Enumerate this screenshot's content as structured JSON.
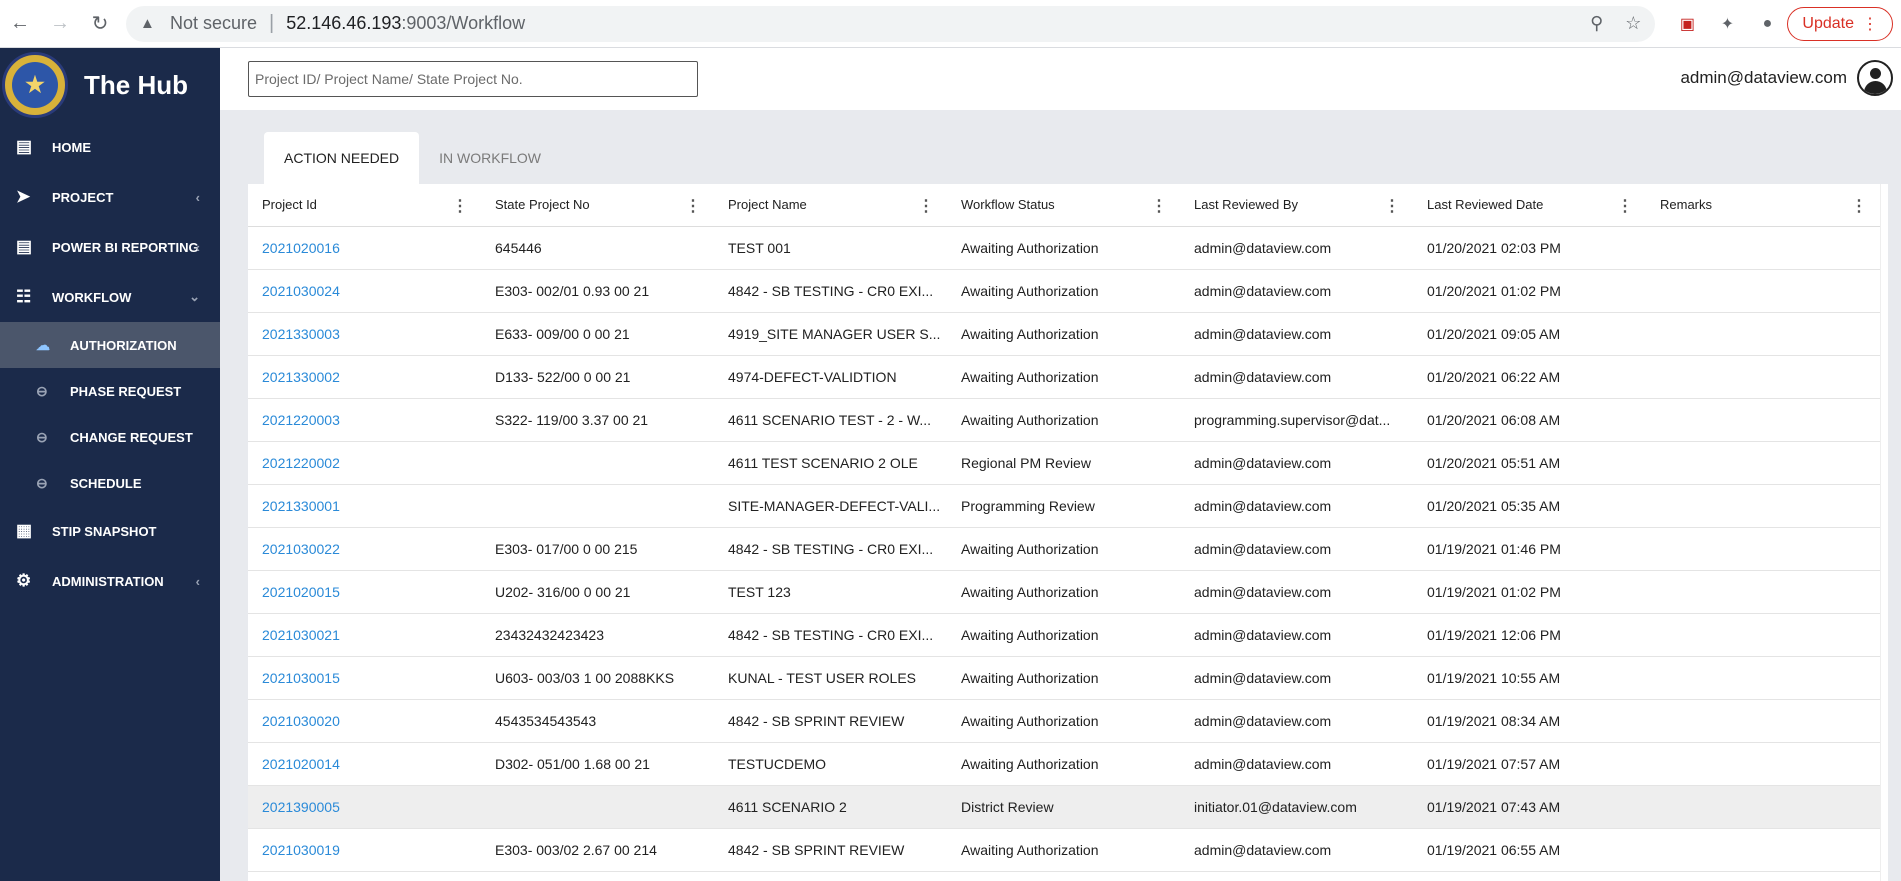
{
  "browser": {
    "security_label": "Not secure",
    "url_host": "52.146.46.193",
    "url_path": ":9003/Workflow",
    "update_label": "Update"
  },
  "sidebar": {
    "brand_title": "The Hub",
    "items": [
      {
        "label": "HOME",
        "icon": "report-icon"
      },
      {
        "label": "PROJECT",
        "icon": "rocket-icon"
      },
      {
        "label": "POWER BI REPORTING",
        "icon": "chart-report-icon"
      },
      {
        "label": "WORKFLOW",
        "icon": "workflow-icon"
      },
      {
        "label": "STIP SNAPSHOT",
        "icon": "snapshot-icon"
      },
      {
        "label": "ADMINISTRATION",
        "icon": "gear-icon"
      }
    ],
    "workflow_sub": [
      {
        "label": "AUTHORIZATION"
      },
      {
        "label": "PHASE REQUEST"
      },
      {
        "label": "CHANGE REQUEST"
      },
      {
        "label": "SCHEDULE"
      }
    ]
  },
  "topbar": {
    "search_placeholder": "Project ID/ Project Name/ State Project No.",
    "user_email": "admin@dataview.com"
  },
  "tabs": [
    {
      "label": "ACTION NEEDED",
      "active": true
    },
    {
      "label": "IN WORKFLOW",
      "active": false
    }
  ],
  "table": {
    "columns": [
      "Project Id",
      "State Project No",
      "Project Name",
      "Workflow Status",
      "Last Reviewed By",
      "Last Reviewed Date",
      "Remarks"
    ],
    "rows": [
      [
        "2021020016",
        "645446",
        "TEST 001",
        "Awaiting Authorization",
        "admin@dataview.com",
        "01/20/2021 02:03 PM",
        ""
      ],
      [
        "2021030024",
        "E303- 002/01 0.93 00 21",
        "4842 - SB TESTING - CR0 EXI...",
        "Awaiting Authorization",
        "admin@dataview.com",
        "01/20/2021 01:02 PM",
        ""
      ],
      [
        "2021330003",
        "E633- 009/00 0 00 21",
        "4919_SITE MANAGER USER S...",
        "Awaiting Authorization",
        "admin@dataview.com",
        "01/20/2021 09:05 AM",
        ""
      ],
      [
        "2021330002",
        "D133- 522/00 0 00 21",
        "4974-DEFECT-VALIDTION",
        "Awaiting Authorization",
        "admin@dataview.com",
        "01/20/2021 06:22 AM",
        ""
      ],
      [
        "2021220003",
        "S322- 119/00 3.37 00 21",
        "4611 SCENARIO TEST - 2 - W...",
        "Awaiting Authorization",
        "programming.supervisor@dat...",
        "01/20/2021 06:08 AM",
        ""
      ],
      [
        "2021220002",
        "",
        "4611 TEST SCENARIO 2 OLE",
        "Regional PM Review",
        "admin@dataview.com",
        "01/20/2021 05:51 AM",
        ""
      ],
      [
        "2021330001",
        "",
        "SITE-MANAGER-DEFECT-VALI...",
        "Programming Review",
        "admin@dataview.com",
        "01/20/2021 05:35 AM",
        ""
      ],
      [
        "2021030022",
        "E303- 017/00 0 00 215",
        "4842 - SB TESTING - CR0 EXI...",
        "Awaiting Authorization",
        "admin@dataview.com",
        "01/19/2021 01:46 PM",
        ""
      ],
      [
        "2021020015",
        "U202- 316/00 0 00 21",
        "TEST 123",
        "Awaiting Authorization",
        "admin@dataview.com",
        "01/19/2021 01:02 PM",
        ""
      ],
      [
        "2021030021",
        "23432432423423",
        "4842 - SB TESTING - CR0 EXI...",
        "Awaiting Authorization",
        "admin@dataview.com",
        "01/19/2021 12:06 PM",
        ""
      ],
      [
        "2021030015",
        "U603- 003/03 1 00 2088KKS",
        "KUNAL - TEST USER ROLES",
        "Awaiting Authorization",
        "admin@dataview.com",
        "01/19/2021 10:55 AM",
        ""
      ],
      [
        "2021030020",
        "4543534543543",
        "4842 - SB SPRINT REVIEW",
        "Awaiting Authorization",
        "admin@dataview.com",
        "01/19/2021 08:34 AM",
        ""
      ],
      [
        "2021020014",
        "D302- 051/00 1.68 00 21",
        "TESTUCDEMO",
        "Awaiting Authorization",
        "admin@dataview.com",
        "01/19/2021 07:57 AM",
        ""
      ],
      [
        "2021390005",
        "",
        "4611 SCENARIO 2",
        "District Review",
        "initiator.01@dataview.com",
        "01/19/2021 07:43 AM",
        ""
      ],
      [
        "2021030019",
        "E303- 003/02 2.67 00 214",
        "4842 - SB SPRINT REVIEW",
        "Awaiting Authorization",
        "admin@dataview.com",
        "01/19/2021 06:55 AM",
        ""
      ]
    ],
    "highlighted_row_index": 13
  },
  "colors": {
    "sidebar_bg": "#1b2a4a",
    "active_sub_bg": "#4b566b",
    "link": "#2a8ad8",
    "content_bg": "#e8eaee"
  }
}
